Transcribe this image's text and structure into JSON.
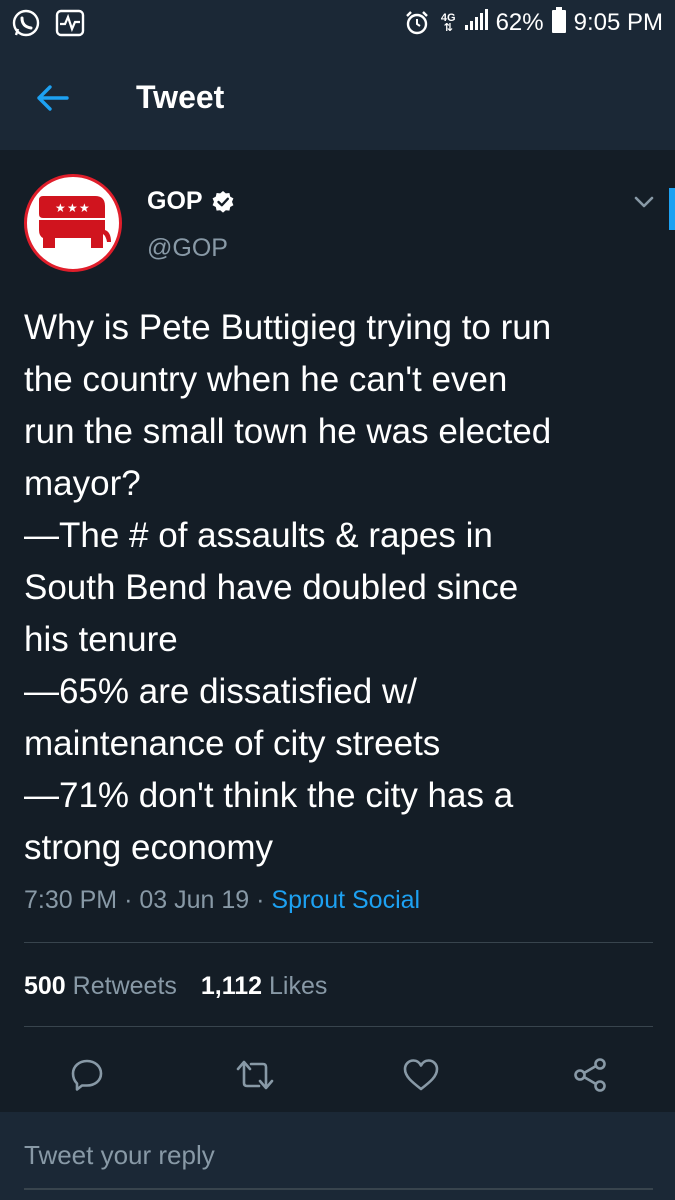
{
  "status_bar": {
    "network": "4G",
    "battery_percent": "62%",
    "time": "9:05 PM"
  },
  "header": {
    "title": "Tweet"
  },
  "tweet": {
    "author": {
      "name": "GOP",
      "handle": "@GOP",
      "verified": true
    },
    "text_lines": [
      "Why is Pete Buttigieg trying to run",
      "the country when he can't even",
      "run the small town he was elected",
      "mayor?",
      "—The # of assaults & rapes in",
      "South Bend have doubled since",
      "his tenure",
      "—65% are dissatisfied w/",
      "maintenance of city streets",
      "—71% don't think the city has a",
      "strong economy"
    ],
    "time": "7:30 PM",
    "separator": "·",
    "date": "03 Jun 19",
    "source": "Sprout Social",
    "retweets_count": "500",
    "retweets_label": "Retweets",
    "likes_count": "1,112",
    "likes_label": "Likes"
  },
  "reply": {
    "placeholder": "Tweet your reply"
  },
  "icons": {
    "back": "arrow-left-icon",
    "verified": "verified-badge-icon",
    "more": "chevron-down-icon",
    "reply": "comment-icon",
    "retweet": "retweet-icon",
    "like": "heart-icon",
    "share": "share-icon"
  },
  "colors": {
    "background": "#141d26",
    "header_bg": "#1b2836",
    "accent": "#1da1f2",
    "secondary_text": "#8899a6",
    "brand_red": "#e01e2b"
  }
}
